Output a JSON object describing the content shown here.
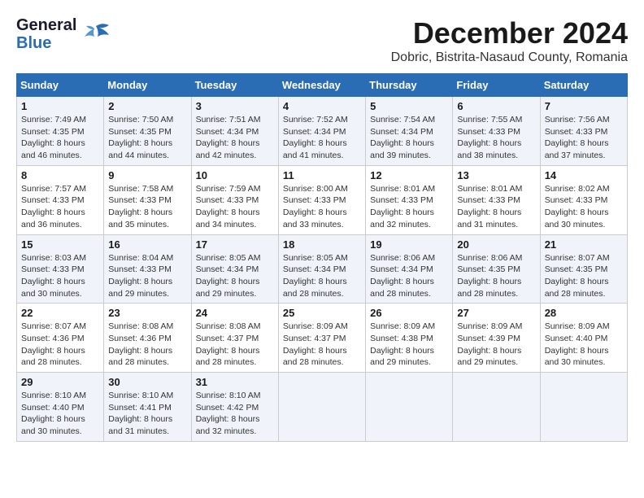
{
  "header": {
    "logo_line1": "General",
    "logo_line2": "Blue",
    "month": "December 2024",
    "location": "Dobric, Bistrita-Nasaud County, Romania"
  },
  "weekdays": [
    "Sunday",
    "Monday",
    "Tuesday",
    "Wednesday",
    "Thursday",
    "Friday",
    "Saturday"
  ],
  "weeks": [
    [
      {
        "day": "1",
        "info": "Sunrise: 7:49 AM\nSunset: 4:35 PM\nDaylight: 8 hours\nand 46 minutes."
      },
      {
        "day": "2",
        "info": "Sunrise: 7:50 AM\nSunset: 4:35 PM\nDaylight: 8 hours\nand 44 minutes."
      },
      {
        "day": "3",
        "info": "Sunrise: 7:51 AM\nSunset: 4:34 PM\nDaylight: 8 hours\nand 42 minutes."
      },
      {
        "day": "4",
        "info": "Sunrise: 7:52 AM\nSunset: 4:34 PM\nDaylight: 8 hours\nand 41 minutes."
      },
      {
        "day": "5",
        "info": "Sunrise: 7:54 AM\nSunset: 4:34 PM\nDaylight: 8 hours\nand 39 minutes."
      },
      {
        "day": "6",
        "info": "Sunrise: 7:55 AM\nSunset: 4:33 PM\nDaylight: 8 hours\nand 38 minutes."
      },
      {
        "day": "7",
        "info": "Sunrise: 7:56 AM\nSunset: 4:33 PM\nDaylight: 8 hours\nand 37 minutes."
      }
    ],
    [
      {
        "day": "8",
        "info": "Sunrise: 7:57 AM\nSunset: 4:33 PM\nDaylight: 8 hours\nand 36 minutes."
      },
      {
        "day": "9",
        "info": "Sunrise: 7:58 AM\nSunset: 4:33 PM\nDaylight: 8 hours\nand 35 minutes."
      },
      {
        "day": "10",
        "info": "Sunrise: 7:59 AM\nSunset: 4:33 PM\nDaylight: 8 hours\nand 34 minutes."
      },
      {
        "day": "11",
        "info": "Sunrise: 8:00 AM\nSunset: 4:33 PM\nDaylight: 8 hours\nand 33 minutes."
      },
      {
        "day": "12",
        "info": "Sunrise: 8:01 AM\nSunset: 4:33 PM\nDaylight: 8 hours\nand 32 minutes."
      },
      {
        "day": "13",
        "info": "Sunrise: 8:01 AM\nSunset: 4:33 PM\nDaylight: 8 hours\nand 31 minutes."
      },
      {
        "day": "14",
        "info": "Sunrise: 8:02 AM\nSunset: 4:33 PM\nDaylight: 8 hours\nand 30 minutes."
      }
    ],
    [
      {
        "day": "15",
        "info": "Sunrise: 8:03 AM\nSunset: 4:33 PM\nDaylight: 8 hours\nand 30 minutes."
      },
      {
        "day": "16",
        "info": "Sunrise: 8:04 AM\nSunset: 4:33 PM\nDaylight: 8 hours\nand 29 minutes."
      },
      {
        "day": "17",
        "info": "Sunrise: 8:05 AM\nSunset: 4:34 PM\nDaylight: 8 hours\nand 29 minutes."
      },
      {
        "day": "18",
        "info": "Sunrise: 8:05 AM\nSunset: 4:34 PM\nDaylight: 8 hours\nand 28 minutes."
      },
      {
        "day": "19",
        "info": "Sunrise: 8:06 AM\nSunset: 4:34 PM\nDaylight: 8 hours\nand 28 minutes."
      },
      {
        "day": "20",
        "info": "Sunrise: 8:06 AM\nSunset: 4:35 PM\nDaylight: 8 hours\nand 28 minutes."
      },
      {
        "day": "21",
        "info": "Sunrise: 8:07 AM\nSunset: 4:35 PM\nDaylight: 8 hours\nand 28 minutes."
      }
    ],
    [
      {
        "day": "22",
        "info": "Sunrise: 8:07 AM\nSunset: 4:36 PM\nDaylight: 8 hours\nand 28 minutes."
      },
      {
        "day": "23",
        "info": "Sunrise: 8:08 AM\nSunset: 4:36 PM\nDaylight: 8 hours\nand 28 minutes."
      },
      {
        "day": "24",
        "info": "Sunrise: 8:08 AM\nSunset: 4:37 PM\nDaylight: 8 hours\nand 28 minutes."
      },
      {
        "day": "25",
        "info": "Sunrise: 8:09 AM\nSunset: 4:37 PM\nDaylight: 8 hours\nand 28 minutes."
      },
      {
        "day": "26",
        "info": "Sunrise: 8:09 AM\nSunset: 4:38 PM\nDaylight: 8 hours\nand 29 minutes."
      },
      {
        "day": "27",
        "info": "Sunrise: 8:09 AM\nSunset: 4:39 PM\nDaylight: 8 hours\nand 29 minutes."
      },
      {
        "day": "28",
        "info": "Sunrise: 8:09 AM\nSunset: 4:40 PM\nDaylight: 8 hours\nand 30 minutes."
      }
    ],
    [
      {
        "day": "29",
        "info": "Sunrise: 8:10 AM\nSunset: 4:40 PM\nDaylight: 8 hours\nand 30 minutes."
      },
      {
        "day": "30",
        "info": "Sunrise: 8:10 AM\nSunset: 4:41 PM\nDaylight: 8 hours\nand 31 minutes."
      },
      {
        "day": "31",
        "info": "Sunrise: 8:10 AM\nSunset: 4:42 PM\nDaylight: 8 hours\nand 32 minutes."
      },
      null,
      null,
      null,
      null
    ]
  ]
}
